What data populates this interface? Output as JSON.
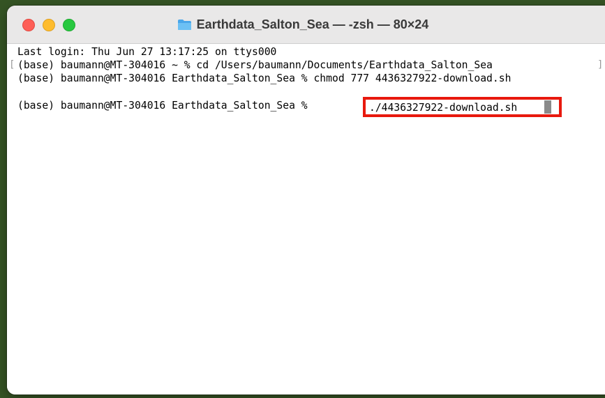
{
  "window": {
    "title": "Earthdata_Salton_Sea — -zsh — 80×24"
  },
  "icons": {
    "folder": "folder-icon"
  },
  "colors": {
    "close": "#fe5f57",
    "minimize": "#febc2e",
    "zoom": "#28c840",
    "highlight": "#e8190e",
    "folder": "#5bb3ef"
  },
  "terminal": {
    "lines": [
      "Last login: Thu Jun 27 13:17:25 on ttys000",
      "(base) baumann@MT-304016 ~ % cd /Users/baumann/Documents/Earthdata_Salton_Sea",
      "(base) baumann@MT-304016 Earthdata_Salton_Sea % chmod 777 4436327922-download.sh",
      "(base) baumann@MT-304016 Earthdata_Salton_Sea % "
    ],
    "current_command": "./4436327922-download.sh",
    "left_bracket": "[",
    "right_bracket": "]"
  }
}
